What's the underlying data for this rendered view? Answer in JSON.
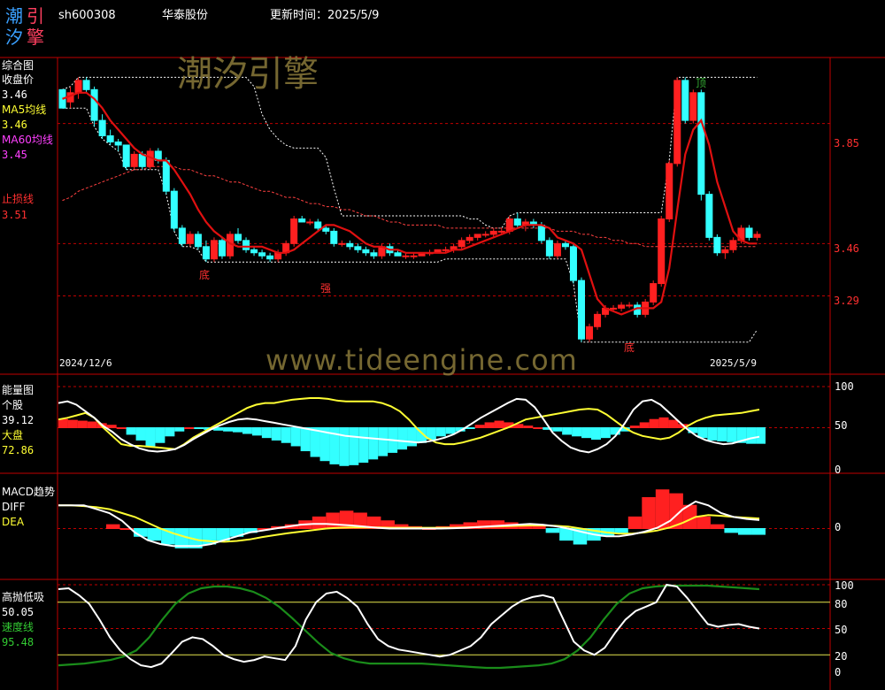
{
  "header": {
    "logo_chars": [
      "潮",
      "引",
      "汐",
      "擎"
    ],
    "code": "sh600308",
    "name": "华泰股份",
    "update_label": "更新时间：",
    "update_date": "2025/5/9"
  },
  "watermark": {
    "title": "潮汐引擎",
    "url": "www.tideengine.com"
  },
  "colors": {
    "up": "#ff2020",
    "down": "#33ffff",
    "ma5": "#e01010",
    "ma60": "#ff4040",
    "white": "#ffffff",
    "yellow": "#ffff33",
    "green": "#1a8c1a",
    "frame": "#c00000"
  },
  "panels": {
    "main": {
      "title": "综合图",
      "close_label": "收盘价",
      "close_value": "3.46",
      "ma5_label": "MA5均线",
      "ma5_value": "3.46",
      "ma60_label": "MA60均线",
      "ma60_value": "3.45",
      "stop_label": "止损线",
      "stop_value": "3.51",
      "date_start": "2024/12/6",
      "date_end": "2025/5/9",
      "annotations": [
        "底",
        "强",
        "底",
        "顶"
      ],
      "price_ticks": [
        "3.85",
        "3.46",
        "3.29"
      ]
    },
    "energy": {
      "title": "能量图",
      "stock_label": "个股",
      "stock_value": "39.12",
      "market_label": "大盘",
      "market_value": "72.86",
      "ticks": [
        "100",
        "50",
        "0"
      ]
    },
    "macd": {
      "title": "MACD趋势",
      "diff_label": "DIFF",
      "dea_label": "DEA",
      "ticks": [
        "0"
      ]
    },
    "kdj": {
      "title": "高抛低吸",
      "value1": "50.05",
      "speed_label": "速度线",
      "speed_value": "95.48",
      "ticks": [
        "100",
        "80",
        "50",
        "20",
        "0"
      ]
    }
  },
  "chart_data": [
    {
      "type": "candlestick",
      "x_range": [
        "2024/12/6",
        "2025/5/9"
      ],
      "ylim": [
        3.05,
        4.05
      ],
      "bars": [
        [
          3.96,
          3.96,
          3.9,
          3.9
        ],
        [
          3.92,
          3.97,
          3.9,
          3.95
        ],
        [
          3.95,
          4.0,
          3.93,
          3.99
        ],
        [
          3.99,
          4.0,
          3.95,
          3.96
        ],
        [
          3.96,
          3.97,
          3.84,
          3.86
        ],
        [
          3.86,
          3.88,
          3.8,
          3.81
        ],
        [
          3.81,
          3.83,
          3.78,
          3.79
        ],
        [
          3.79,
          3.8,
          3.76,
          3.78
        ],
        [
          3.78,
          3.78,
          3.7,
          3.71
        ],
        [
          3.71,
          3.76,
          3.7,
          3.75
        ],
        [
          3.75,
          3.76,
          3.7,
          3.71
        ],
        [
          3.71,
          3.77,
          3.7,
          3.76
        ],
        [
          3.76,
          3.77,
          3.72,
          3.73
        ],
        [
          3.73,
          3.74,
          3.62,
          3.63
        ],
        [
          3.63,
          3.64,
          3.5,
          3.51
        ],
        [
          3.51,
          3.52,
          3.45,
          3.46
        ],
        [
          3.46,
          3.5,
          3.45,
          3.49
        ],
        [
          3.49,
          3.5,
          3.44,
          3.45
        ],
        [
          3.45,
          3.47,
          3.4,
          3.41
        ],
        [
          3.41,
          3.48,
          3.4,
          3.47
        ],
        [
          3.47,
          3.48,
          3.41,
          3.42
        ],
        [
          3.42,
          3.5,
          3.41,
          3.49
        ],
        [
          3.49,
          3.51,
          3.46,
          3.47
        ],
        [
          3.47,
          3.48,
          3.43,
          3.44
        ],
        [
          3.44,
          3.45,
          3.42,
          3.43
        ],
        [
          3.43,
          3.44,
          3.41,
          3.42
        ],
        [
          3.42,
          3.43,
          3.4,
          3.41
        ],
        [
          3.41,
          3.44,
          3.4,
          3.43
        ],
        [
          3.43,
          3.47,
          3.42,
          3.46
        ],
        [
          3.46,
          3.55,
          3.45,
          3.54
        ],
        [
          3.54,
          3.55,
          3.53,
          3.53
        ],
        [
          3.53,
          3.54,
          3.52,
          3.53
        ],
        [
          3.53,
          3.54,
          3.5,
          3.51
        ],
        [
          3.51,
          3.52,
          3.49,
          3.5
        ],
        [
          3.5,
          3.51,
          3.45,
          3.46
        ],
        [
          3.46,
          3.47,
          3.45,
          3.46
        ],
        [
          3.46,
          3.47,
          3.44,
          3.45
        ],
        [
          3.45,
          3.46,
          3.43,
          3.44
        ],
        [
          3.44,
          3.45,
          3.42,
          3.43
        ],
        [
          3.43,
          3.44,
          3.41,
          3.42
        ],
        [
          3.42,
          3.46,
          3.41,
          3.45
        ],
        [
          3.45,
          3.46,
          3.42,
          3.43
        ],
        [
          3.43,
          3.44,
          3.42,
          3.42
        ],
        [
          3.42,
          3.43,
          3.41,
          3.42
        ],
        [
          3.42,
          3.43,
          3.41,
          3.42
        ],
        [
          3.42,
          3.43,
          3.42,
          3.43
        ],
        [
          3.43,
          3.44,
          3.42,
          3.43
        ],
        [
          3.43,
          3.44,
          3.43,
          3.44
        ],
        [
          3.44,
          3.45,
          3.43,
          3.44
        ],
        [
          3.44,
          3.46,
          3.43,
          3.45
        ],
        [
          3.45,
          3.48,
          3.44,
          3.47
        ],
        [
          3.47,
          3.49,
          3.46,
          3.48
        ],
        [
          3.48,
          3.49,
          3.47,
          3.49
        ],
        [
          3.49,
          3.5,
          3.48,
          3.49
        ],
        [
          3.49,
          3.51,
          3.48,
          3.5
        ],
        [
          3.5,
          3.51,
          3.49,
          3.5
        ],
        [
          3.5,
          3.55,
          3.49,
          3.54
        ],
        [
          3.54,
          3.56,
          3.51,
          3.52
        ],
        [
          3.52,
          3.54,
          3.5,
          3.53
        ],
        [
          3.53,
          3.54,
          3.51,
          3.52
        ],
        [
          3.52,
          3.53,
          3.46,
          3.47
        ],
        [
          3.47,
          3.48,
          3.41,
          3.42
        ],
        [
          3.42,
          3.47,
          3.41,
          3.46
        ],
        [
          3.46,
          3.47,
          3.44,
          3.45
        ],
        [
          3.45,
          3.46,
          3.33,
          3.34
        ],
        [
          3.34,
          3.35,
          3.14,
          3.15
        ],
        [
          3.15,
          3.2,
          3.14,
          3.19
        ],
        [
          3.19,
          3.24,
          3.18,
          3.23
        ],
        [
          3.23,
          3.26,
          3.22,
          3.25
        ],
        [
          3.25,
          3.26,
          3.24,
          3.25
        ],
        [
          3.25,
          3.27,
          3.24,
          3.26
        ],
        [
          3.26,
          3.27,
          3.25,
          3.26
        ],
        [
          3.26,
          3.27,
          3.22,
          3.23
        ],
        [
          3.23,
          3.28,
          3.22,
          3.27
        ],
        [
          3.27,
          3.34,
          3.26,
          3.33
        ],
        [
          3.33,
          3.55,
          3.32,
          3.54
        ],
        [
          3.54,
          3.73,
          3.53,
          3.72
        ],
        [
          3.72,
          4.0,
          3.71,
          3.99
        ],
        [
          3.99,
          4.0,
          3.85,
          3.86
        ],
        [
          3.86,
          3.96,
          3.85,
          3.95
        ],
        [
          3.95,
          3.96,
          3.6,
          3.62
        ],
        [
          3.62,
          3.63,
          3.47,
          3.48
        ],
        [
          3.48,
          3.49,
          3.42,
          3.43
        ],
        [
          3.43,
          3.45,
          3.41,
          3.44
        ],
        [
          3.44,
          3.48,
          3.43,
          3.47
        ],
        [
          3.47,
          3.52,
          3.46,
          3.51
        ],
        [
          3.51,
          3.52,
          3.47,
          3.48
        ],
        [
          3.48,
          3.5,
          3.47,
          3.49
        ]
      ],
      "ma5": [
        3.93,
        3.94,
        3.95,
        3.95,
        3.93,
        3.9,
        3.86,
        3.83,
        3.8,
        3.77,
        3.75,
        3.74,
        3.73,
        3.73,
        3.7,
        3.66,
        3.62,
        3.57,
        3.53,
        3.5,
        3.48,
        3.46,
        3.45,
        3.45,
        3.45,
        3.45,
        3.44,
        3.43,
        3.43,
        3.44,
        3.46,
        3.48,
        3.5,
        3.52,
        3.52,
        3.51,
        3.5,
        3.48,
        3.46,
        3.45,
        3.45,
        3.44,
        3.44,
        3.43,
        3.43,
        3.43,
        3.43,
        3.43,
        3.43,
        3.44,
        3.44,
        3.45,
        3.46,
        3.47,
        3.48,
        3.49,
        3.5,
        3.51,
        3.52,
        3.52,
        3.52,
        3.51,
        3.48,
        3.47,
        3.46,
        3.44,
        3.36,
        3.28,
        3.25,
        3.24,
        3.23,
        3.24,
        3.25,
        3.25,
        3.25,
        3.27,
        3.38,
        3.57,
        3.75,
        3.83,
        3.86,
        3.78,
        3.66,
        3.58,
        3.5,
        3.47,
        3.46,
        3.46
      ],
      "ma60": [
        3.6,
        3.61,
        3.63,
        3.64,
        3.65,
        3.66,
        3.67,
        3.68,
        3.69,
        3.7,
        3.7,
        3.71,
        3.71,
        3.71,
        3.71,
        3.7,
        3.7,
        3.69,
        3.68,
        3.68,
        3.67,
        3.66,
        3.66,
        3.65,
        3.64,
        3.63,
        3.63,
        3.62,
        3.61,
        3.61,
        3.6,
        3.59,
        3.59,
        3.58,
        3.58,
        3.57,
        3.57,
        3.56,
        3.55,
        3.55,
        3.54,
        3.53,
        3.53,
        3.52,
        3.52,
        3.52,
        3.52,
        3.52,
        3.51,
        3.51,
        3.51,
        3.51,
        3.51,
        3.51,
        3.51,
        3.51,
        3.51,
        3.51,
        3.51,
        3.51,
        3.51,
        3.51,
        3.5,
        3.5,
        3.5,
        3.49,
        3.49,
        3.48,
        3.48,
        3.47,
        3.47,
        3.46,
        3.46,
        3.45,
        3.45,
        3.45,
        3.45,
        3.45,
        3.45,
        3.45,
        3.45,
        3.45,
        3.45,
        3.45,
        3.45,
        3.45,
        3.45,
        3.45
      ],
      "price_levels": [
        3.85,
        3.46,
        3.29
      ]
    },
    {
      "type": "line+bar",
      "name": "energy",
      "ylim": [
        0,
        100
      ],
      "stock": [
        80,
        82,
        78,
        70,
        62,
        52,
        45,
        36,
        30,
        25,
        22,
        21,
        22,
        24,
        29,
        36,
        42,
        48,
        53,
        57,
        60,
        61,
        60,
        58,
        56,
        54,
        52,
        50,
        48,
        46,
        44,
        42,
        40,
        39,
        38,
        37,
        36,
        35,
        34,
        33,
        32,
        33,
        35,
        38,
        42,
        48,
        55,
        62,
        68,
        74,
        80,
        85,
        84,
        75,
        60,
        44,
        34,
        26,
        22,
        20,
        24,
        30,
        40,
        55,
        72,
        82,
        84,
        78,
        68,
        58,
        48,
        40,
        35,
        32,
        30,
        31,
        34,
        37,
        39
      ],
      "market": [
        60,
        62,
        65,
        68,
        62,
        50,
        40,
        30,
        28,
        28,
        27,
        26,
        25,
        24,
        30,
        38,
        44,
        50,
        56,
        62,
        68,
        74,
        78,
        80,
        80,
        82,
        84,
        85,
        86,
        86,
        85,
        83,
        82,
        82,
        82,
        82,
        80,
        76,
        70,
        60,
        48,
        38,
        32,
        30,
        30,
        32,
        35,
        38,
        42,
        46,
        50,
        55,
        60,
        62,
        64,
        66,
        68,
        70,
        72,
        73,
        72,
        66,
        58,
        50,
        44,
        40,
        38,
        36,
        38,
        44,
        52,
        58,
        62,
        65,
        66,
        67,
        68,
        70,
        72
      ],
      "bars": [
        10,
        9,
        8,
        7,
        5,
        3,
        0,
        -8,
        -15,
        -22,
        -18,
        -10,
        -4,
        0,
        -1,
        -2,
        -3,
        -4,
        -5,
        -7,
        -9,
        -12,
        -15,
        -18,
        -22,
        -28,
        -35,
        -40,
        -44,
        -46,
        -45,
        -42,
        -38,
        -34,
        -30,
        -26,
        -22,
        -18,
        -14,
        -10,
        -7,
        -4,
        -1,
        3,
        6,
        8,
        6,
        4,
        2,
        0,
        -2,
        -4,
        -8,
        -10,
        -12,
        -14,
        -12,
        -8,
        -4,
        2,
        6,
        10,
        12,
        9,
        4,
        -6,
        -12,
        -15,
        -16,
        -17,
        -18,
        -19,
        -19
      ]
    },
    {
      "type": "line+bar",
      "name": "MACD",
      "ylim": [
        -0.12,
        0.12
      ],
      "diff": [
        0.06,
        0.06,
        0.06,
        0.05,
        0.04,
        0.02,
        -0.01,
        -0.03,
        -0.04,
        -0.045,
        -0.045,
        -0.045,
        -0.04,
        -0.03,
        -0.02,
        -0.01,
        -0.005,
        0.0,
        0.005,
        0.01,
        0.012,
        0.012,
        0.01,
        0.008,
        0.005,
        0.002,
        0.0,
        0.0,
        0.0,
        0.0,
        0.0,
        0.001,
        0.002,
        0.004,
        0.006,
        0.008,
        0.01,
        0.012,
        0.01,
        0.006,
        0.0,
        -0.008,
        -0.015,
        -0.02,
        -0.02,
        -0.015,
        -0.008,
        0.002,
        0.02,
        0.05,
        0.07,
        0.06,
        0.04,
        0.03,
        0.025,
        0.022
      ],
      "dea": [
        0.06,
        0.06,
        0.058,
        0.055,
        0.05,
        0.04,
        0.03,
        0.015,
        0.0,
        -0.012,
        -0.022,
        -0.03,
        -0.033,
        -0.034,
        -0.032,
        -0.028,
        -0.022,
        -0.017,
        -0.012,
        -0.008,
        -0.004,
        0.0,
        0.002,
        0.003,
        0.003,
        0.003,
        0.002,
        0.002,
        0.002,
        0.002,
        0.002,
        0.002,
        0.003,
        0.004,
        0.005,
        0.006,
        0.007,
        0.008,
        0.008,
        0.007,
        0.005,
        0.0,
        -0.005,
        -0.01,
        -0.013,
        -0.013,
        -0.01,
        -0.005,
        0.003,
        0.015,
        0.03,
        0.035,
        0.033,
        0.03,
        0.028,
        0.026
      ],
      "bars": [
        0.01,
        0.0,
        -0.02,
        -0.03,
        -0.04,
        -0.05,
        -0.05,
        -0.04,
        -0.03,
        -0.02,
        -0.01,
        0.0,
        0.005,
        0.01,
        0.02,
        0.03,
        0.04,
        0.045,
        0.04,
        0.03,
        0.02,
        0.01,
        0.005,
        0.0,
        0.005,
        0.01,
        0.015,
        0.02,
        0.02,
        0.015,
        0.01,
        0.005,
        -0.01,
        -0.03,
        -0.04,
        -0.03,
        -0.02,
        -0.01,
        0.03,
        0.08,
        0.1,
        0.09,
        0.06,
        0.03,
        0.01,
        -0.01,
        -0.015,
        -0.015
      ]
    },
    {
      "type": "line",
      "name": "高抛低吸",
      "ylim": [
        0,
        100
      ],
      "white": [
        95,
        96,
        88,
        78,
        60,
        40,
        25,
        15,
        8,
        6,
        10,
        22,
        35,
        40,
        38,
        30,
        20,
        15,
        12,
        14,
        18,
        16,
        14,
        30,
        60,
        80,
        90,
        92,
        85,
        75,
        55,
        38,
        30,
        26,
        24,
        22,
        20,
        18,
        20,
        25,
        30,
        40,
        55,
        65,
        75,
        82,
        86,
        88,
        85,
        60,
        35,
        25,
        20,
        28,
        45,
        60,
        70,
        75,
        80,
        100,
        98,
        85,
        70,
        55,
        52,
        54,
        55,
        52,
        50
      ],
      "green": [
        8,
        9,
        10,
        12,
        14,
        18,
        25,
        40,
        60,
        78,
        90,
        96,
        98,
        98,
        96,
        92,
        85,
        75,
        62,
        48,
        34,
        22,
        16,
        12,
        10,
        10,
        10,
        10,
        10,
        9,
        8,
        7,
        6,
        5,
        5,
        6,
        7,
        8,
        10,
        15,
        25,
        40,
        60,
        78,
        90,
        96,
        98,
        99,
        99,
        99,
        99,
        98,
        97,
        96,
        95
      ]
    }
  ]
}
